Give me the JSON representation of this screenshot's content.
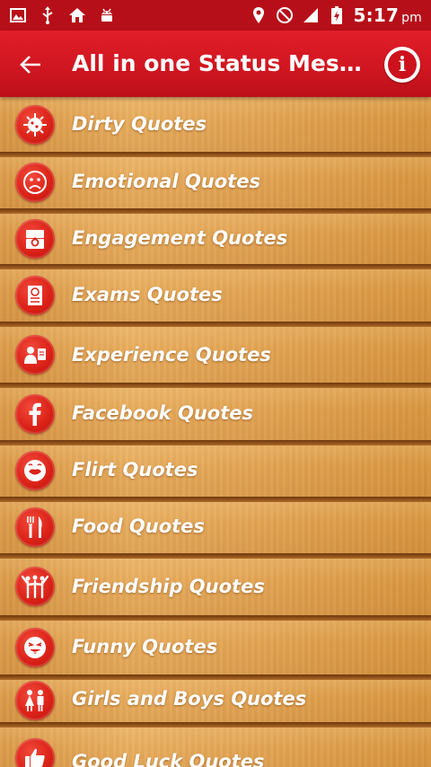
{
  "status_bar": {
    "time": "5:17",
    "ampm": "pm"
  },
  "app_bar": {
    "title": "All in one Status Mess..."
  },
  "items": [
    {
      "label": "Dirty Quotes",
      "icon": "virus-icon"
    },
    {
      "label": "Emotional Quotes",
      "icon": "sad-face-icon"
    },
    {
      "label": "Engagement Quotes",
      "icon": "ring-box-icon"
    },
    {
      "label": "Exams Quotes",
      "icon": "exam-paper-icon"
    },
    {
      "label": "Experience Quotes",
      "icon": "person-badge-icon"
    },
    {
      "label": "Facebook Quotes",
      "icon": "facebook-icon"
    },
    {
      "label": "Flirt Quotes",
      "icon": "lips-icon"
    },
    {
      "label": "Food Quotes",
      "icon": "fork-knife-icon"
    },
    {
      "label": "Friendship Quotes",
      "icon": "friends-icon"
    },
    {
      "label": "Funny Quotes",
      "icon": "tongue-face-icon"
    },
    {
      "label": "Girls and Boys Quotes",
      "icon": "girl-boy-icon"
    },
    {
      "label": "Good Luck Quotes",
      "icon": "thumbs-up-icon"
    }
  ],
  "colors": {
    "status_bar": "#b70f19",
    "app_bar": "#d11621",
    "icon_red": "#db2218",
    "wood": "#e3a453",
    "divider": "#7a4213"
  }
}
